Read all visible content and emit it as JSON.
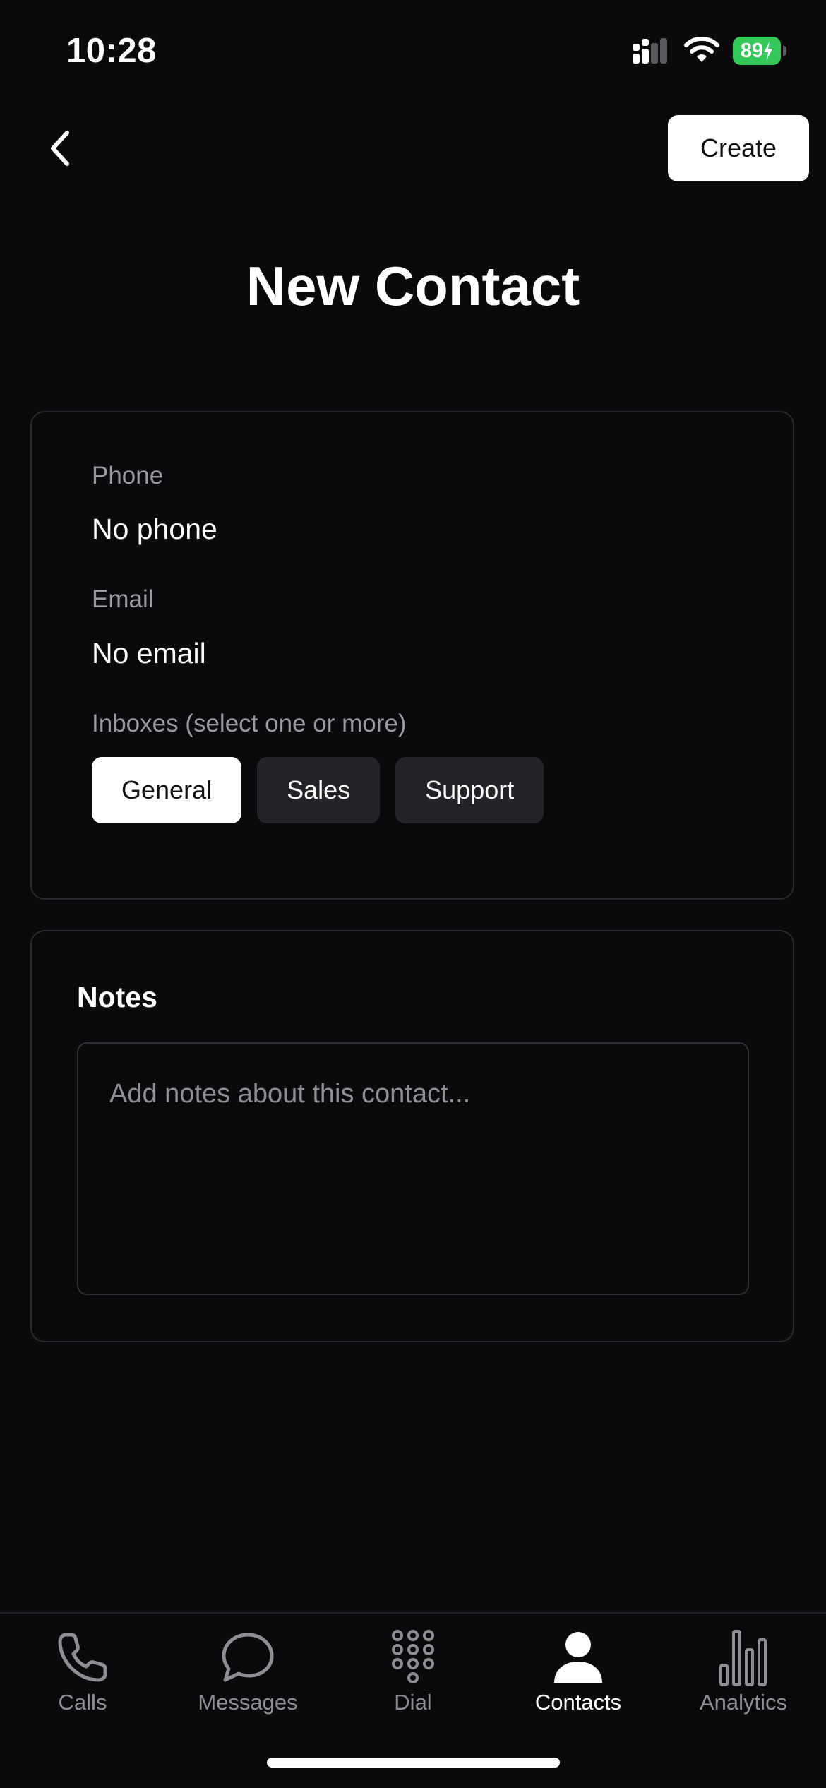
{
  "status_bar": {
    "time": "10:28",
    "battery_level": "89",
    "icons": [
      "signal-icon",
      "wifi-icon",
      "battery-icon",
      "charging-bolt-icon"
    ]
  },
  "header": {
    "back_icon": "chevron-left-icon",
    "create_label": "Create",
    "title": "New Contact"
  },
  "details": {
    "phone_label": "Phone",
    "phone_value": "No phone",
    "email_label": "Email",
    "email_value": "No email",
    "inboxes_label": "Inboxes (select one or more)",
    "inboxes": [
      {
        "label": "General",
        "selected": true
      },
      {
        "label": "Sales",
        "selected": false
      },
      {
        "label": "Support",
        "selected": false
      }
    ]
  },
  "notes": {
    "title": "Notes",
    "placeholder": "Add notes about this contact...",
    "value": ""
  },
  "tabs": [
    {
      "label": "Calls",
      "icon": "phone-icon",
      "active": false
    },
    {
      "label": "Messages",
      "icon": "chat-bubble-icon",
      "active": false
    },
    {
      "label": "Dial",
      "icon": "keypad-icon",
      "active": false
    },
    {
      "label": "Contacts",
      "icon": "person-icon",
      "active": true
    },
    {
      "label": "Analytics",
      "icon": "bar-chart-icon",
      "active": false
    }
  ],
  "colors": {
    "background": "#0a0a0c",
    "card_border": "#2a2a2e",
    "chip_selected": "#ffffff",
    "chip_unselected": "#242428",
    "battery": "#34c759",
    "muted_text": "#8e8e93"
  }
}
